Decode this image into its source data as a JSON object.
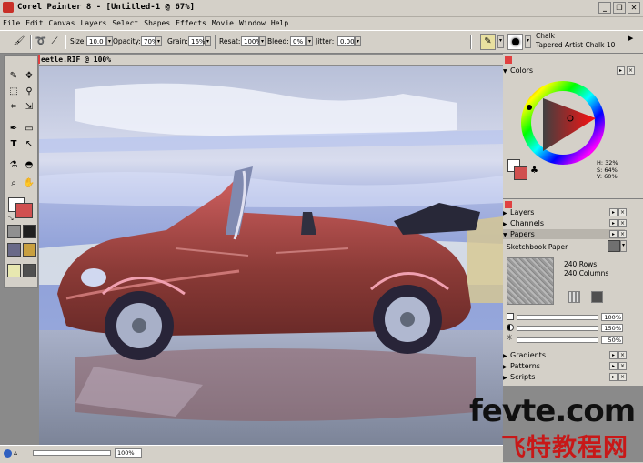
{
  "app": {
    "title": "Corel Painter 8 - [Untitled-1 @ 67%]"
  },
  "window_buttons": {
    "minimize": "_",
    "restore": "❐",
    "close": "✕"
  },
  "menu": [
    "File",
    "Edit",
    "Canvas",
    "Layers",
    "Select",
    "Shapes",
    "Effects",
    "Movie",
    "Window",
    "Help"
  ],
  "property_bar": {
    "size_label": "Size:",
    "size_value": "10.0",
    "opacity_label": "Opacity:",
    "opacity_value": "70%",
    "grain_label": "Grain:",
    "grain_value": "16%",
    "resat_label": "Resat:",
    "resat_value": "100%",
    "bleed_label": "Bleed:",
    "bleed_value": "0%",
    "jitter_label": "Jitter:",
    "jitter_value": "0.00"
  },
  "brush_selector": {
    "category": "Chalk",
    "variant": "Tapered Artist Chalk 10"
  },
  "document": {
    "title": "eetle.RIF @ 100%",
    "zoom": "100%"
  },
  "colors_panel": {
    "title": "Colors",
    "h": "H: 32%",
    "s": "S: 64%",
    "v": "V: 60%",
    "main_color": "#d05050",
    "secondary_color": "#ffffff"
  },
  "panels": {
    "layers": "Layers",
    "channels": "Channels",
    "papers": "Papers",
    "gradients": "Gradients",
    "patterns": "Patterns",
    "scripts": "Scripts"
  },
  "papers_panel": {
    "paper_name": "Sketchbook Paper",
    "rows": "240 Rows",
    "columns": "240 Columns",
    "scale": "100%",
    "contrast": "150%",
    "brightness": "50%"
  },
  "watermark": {
    "line1": "fevte.com",
    "line2": "飞特教程网"
  }
}
